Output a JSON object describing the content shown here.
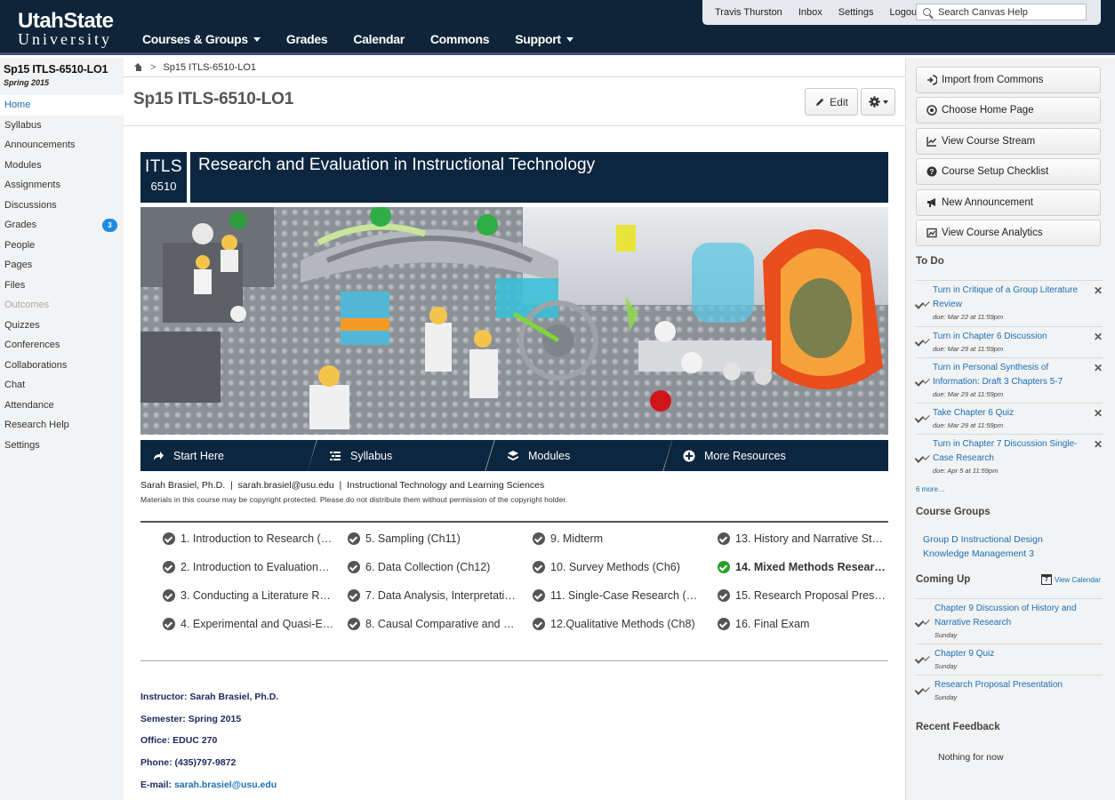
{
  "header": {
    "logo_line1": "UtahState",
    "logo_line2": "University",
    "nav": [
      {
        "label": "Courses & Groups",
        "dropdown": true
      },
      {
        "label": "Grades"
      },
      {
        "label": "Calendar"
      },
      {
        "label": "Commons"
      },
      {
        "label": "Support",
        "dropdown": true
      }
    ],
    "user_links": [
      "Travis Thurston",
      "Inbox",
      "Settings",
      "Logout"
    ],
    "search_placeholder": "Search Canvas Help"
  },
  "course": {
    "name": "Sp15 ITLS-6510-LO1",
    "term": "Spring 2015"
  },
  "left_nav": [
    {
      "label": "Home",
      "active": true
    },
    {
      "label": "Syllabus"
    },
    {
      "label": "Announcements"
    },
    {
      "label": "Modules"
    },
    {
      "label": "Assignments"
    },
    {
      "label": "Discussions"
    },
    {
      "label": "Grades",
      "badge": "3"
    },
    {
      "label": "People"
    },
    {
      "label": "Pages"
    },
    {
      "label": "Files"
    },
    {
      "label": "Outcomes",
      "disabled": true
    },
    {
      "label": "Quizzes"
    },
    {
      "label": "Conferences"
    },
    {
      "label": "Collaborations"
    },
    {
      "label": "Chat"
    },
    {
      "label": "Attendance"
    },
    {
      "label": "Research Help"
    },
    {
      "label": "Settings"
    }
  ],
  "breadcrumb": {
    "current": "Sp15 ITLS-6510-LO1",
    "separator": ">"
  },
  "page": {
    "title": "Sp15 ITLS-6510-LO1",
    "edit_label": "Edit"
  },
  "banner": {
    "code_line1": "ITLS",
    "code_line2": "6510",
    "title": "Research and Evaluation in Instructional Technology"
  },
  "quick_links": [
    {
      "label": "Start Here",
      "icon": "share-arrow-icon"
    },
    {
      "label": "Syllabus",
      "icon": "list-icon"
    },
    {
      "label": "Modules",
      "icon": "stack-icon"
    },
    {
      "label": "More Resources",
      "icon": "plus-circle-icon"
    }
  ],
  "contact_line": "Sarah Brasiel, Ph.D.  |  sarah.brasiel@usu.edu  |  Instructional Technology and Learning Sciences",
  "copyright": "Materials in this course may be copyright protected. Please do not distribute them without permission of the copyright holder.",
  "modules": [
    {
      "label": "1. Introduction to Research (…"
    },
    {
      "label": "2. Introduction to Evaluation…"
    },
    {
      "label": "3. Conducting a Literature R…"
    },
    {
      "label": "4. Experimental and Quasi-E…"
    },
    {
      "label": "5. Sampling (Ch11)"
    },
    {
      "label": "6. Data Collection (Ch12)"
    },
    {
      "label": "7. Data Analysis, Interpretati…"
    },
    {
      "label": "8. Causal Comparative and …"
    },
    {
      "label": "9. Midterm"
    },
    {
      "label": "10. Survey Methods (Ch6)"
    },
    {
      "label": "11. Single-Case Research (…"
    },
    {
      "label": "12.Qualitative Methods (Ch8)"
    },
    {
      "label": "13. History and Narrative St…"
    },
    {
      "label": "14. Mixed Methods Resear…",
      "current": true
    },
    {
      "label": "15. Research Proposal Pres…"
    },
    {
      "label": "16. Final Exam"
    }
  ],
  "instructor_info": {
    "instructor": "Instructor: Sarah Brasiel, Ph.D.",
    "semester": "Semester: Spring 2015",
    "office": "Office: EDUC 270",
    "phone": "Phone: (435)797-9872",
    "email_label": "E-mail:",
    "email": "sarah.brasiel@usu.edu"
  },
  "right_buttons": [
    {
      "label": "Import from Commons",
      "icon": "import-icon"
    },
    {
      "label": "Choose Home Page",
      "icon": "target-icon"
    },
    {
      "label": "View Course Stream",
      "icon": "chart-icon"
    },
    {
      "label": "Course Setup Checklist",
      "icon": "question-icon"
    },
    {
      "label": "New Announcement",
      "icon": "megaphone-icon"
    },
    {
      "label": "View Course Analytics",
      "icon": "analytics-icon"
    }
  ],
  "todo": {
    "heading": "To Do",
    "items": [
      {
        "title": "Turn in Critique of a Group Literature Review",
        "due": "due: Mar 22 at 11:59pm"
      },
      {
        "title": "Turn in Chapter 6 Discussion",
        "due": "due: Mar 29 at 11:59pm"
      },
      {
        "title": "Turn in Personal Synthesis of Information: Draft 3 Chapters 5-7",
        "due": "due: Mar 29 at 11:59pm"
      },
      {
        "title": "Take Chapter 6 Quiz",
        "due": "due: Mar 29 at 11:59pm"
      },
      {
        "title": "Turn in Chapter 7 Discussion Single-Case Research",
        "due": "due: Apr 5 at 11:59pm"
      }
    ],
    "more": "6 more…"
  },
  "course_groups": {
    "heading": "Course Groups",
    "group": "Group D Instructional Design Knowledge Management 3"
  },
  "coming_up": {
    "heading": "Coming Up",
    "calendar_label": "View Calendar",
    "calendar_day": "7",
    "items": [
      {
        "title": "Chapter 9 Discussion of History and Narrative Research",
        "when": "Sunday"
      },
      {
        "title": "Chapter 9 Quiz",
        "when": "Sunday"
      },
      {
        "title": "Research Proposal Presentation",
        "when": "Sunday"
      }
    ]
  },
  "recent_feedback": {
    "heading": "Recent Feedback",
    "empty": "Nothing for now"
  }
}
